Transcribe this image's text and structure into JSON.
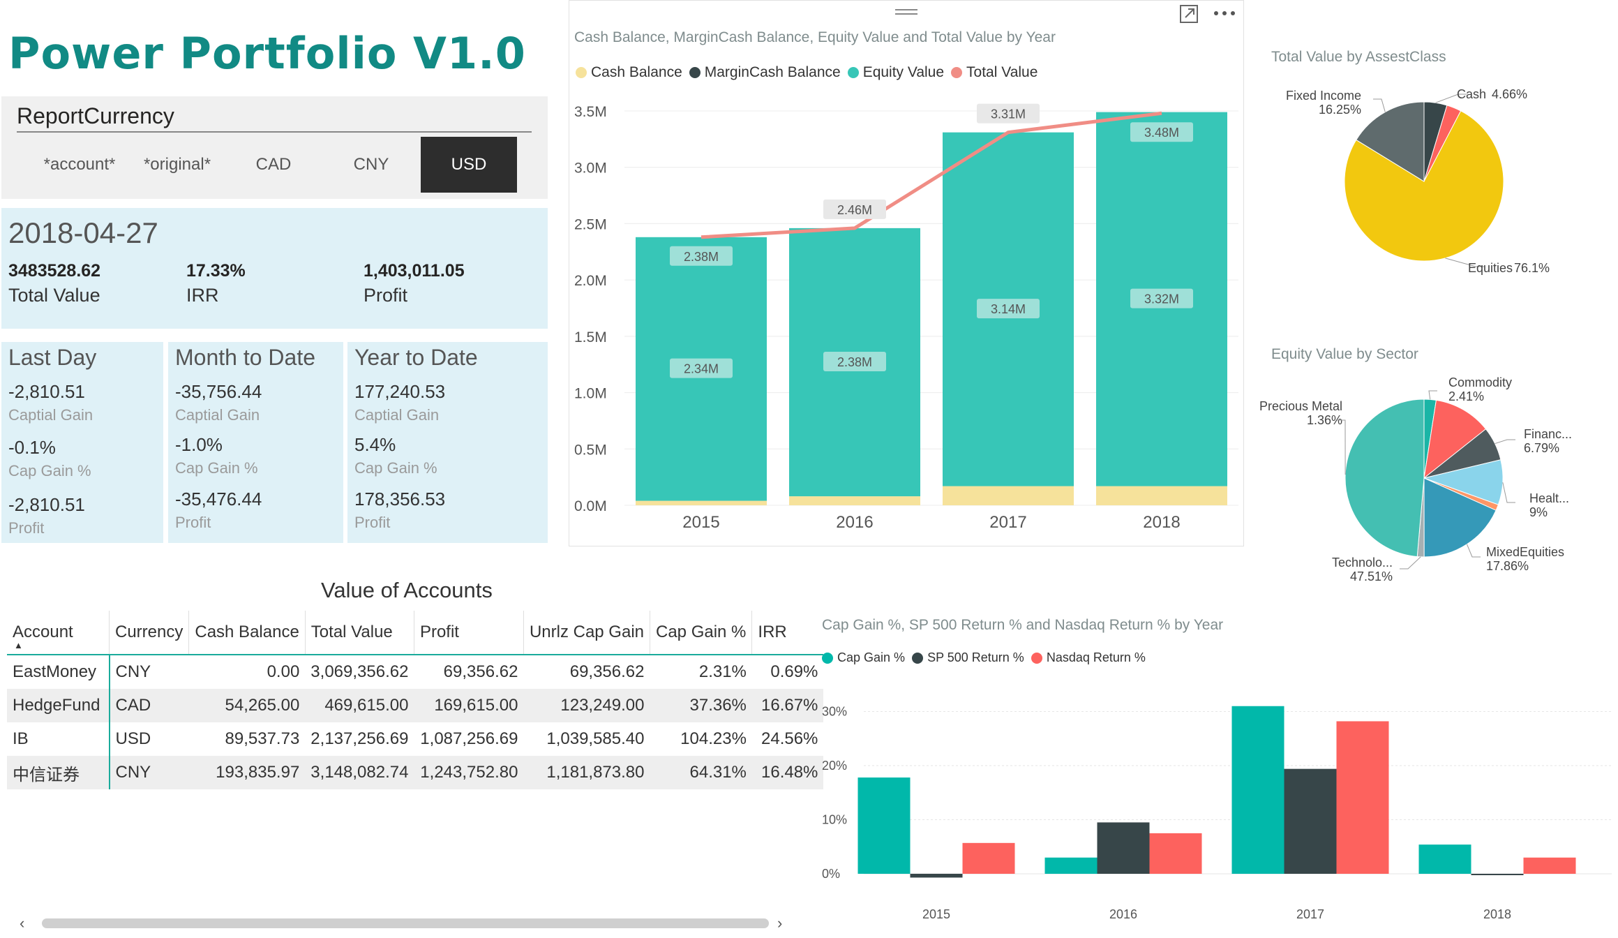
{
  "app_title": "Power Portfolio V1.0",
  "slicer": {
    "title": "ReportCurrency",
    "options": [
      "*account*",
      "*original*",
      "CAD",
      "CNY",
      "USD"
    ],
    "selected": "USD"
  },
  "kpi": {
    "date": "2018-04-27",
    "total_value": "3483528.62",
    "total_value_label": "Total Value",
    "irr": "17.33%",
    "irr_label": "IRR",
    "profit": "1,403,011.05",
    "profit_label": "Profit"
  },
  "periods": [
    {
      "title": "Last Day",
      "cap_gain": "-2,810.51",
      "cap_gain_label": "Captial Gain",
      "cap_gain_pct": "-0.1%",
      "cap_gain_pct_label": "Cap Gain %",
      "profit": "-2,810.51",
      "profit_label": "Profit"
    },
    {
      "title": "Month to Date",
      "cap_gain": "-35,756.44",
      "cap_gain_label": "Captial Gain",
      "cap_gain_pct": "-1.0%",
      "cap_gain_pct_label": "Cap Gain %",
      "profit": "-35,476.44",
      "profit_label": "Profit"
    },
    {
      "title": "Year to Date",
      "cap_gain": "177,240.53",
      "cap_gain_label": "Captial Gain",
      "cap_gain_pct": "5.4%",
      "cap_gain_pct_label": "Cap Gain %",
      "profit": "178,356.53",
      "profit_label": "Profit"
    }
  ],
  "accounts": {
    "title": "Value of Accounts",
    "columns": [
      "Account",
      "Currency",
      "Cash Balance",
      "Total Value",
      "Profit",
      "Unrlz Cap Gain",
      "Cap Gain %",
      "IRR"
    ],
    "rows": [
      [
        "EastMoney",
        "CNY",
        "0.00",
        "3,069,356.62",
        "69,356.62",
        "69,356.62",
        "2.31%",
        "0.69%"
      ],
      [
        "HedgeFund",
        "CAD",
        "54,265.00",
        "469,615.00",
        "169,615.00",
        "123,249.00",
        "37.36%",
        "16.67%"
      ],
      [
        "IB",
        "USD",
        "89,537.73",
        "2,137,256.69",
        "1,087,256.69",
        "1,039,585.40",
        "104.23%",
        "24.56%"
      ],
      [
        "中信证券",
        "CNY",
        "193,835.97",
        "3,148,082.74",
        "1,243,752.80",
        "1,181,873.80",
        "64.31%",
        "16.48%"
      ]
    ]
  },
  "colors": {
    "teal": "#37c6b7",
    "cash": "#f6e29b",
    "line": "#f08d85",
    "dark": "#374649",
    "red": "#fd625e",
    "yellow": "#f2c80f",
    "title": "#118a84"
  },
  "chart_data": [
    {
      "type": "bar",
      "stacked": true,
      "title": "Cash Balance, MarginCash Balance, Equity Value and Total Value by Year",
      "categories": [
        "2015",
        "2016",
        "2017",
        "2018"
      ],
      "series": [
        {
          "name": "Cash Balance",
          "color": "#f6e29b",
          "values": [
            0.04,
            0.08,
            0.17,
            0.17
          ]
        },
        {
          "name": "MarginCash Balance",
          "color": "#374649",
          "values": [
            0,
            0,
            0,
            0
          ]
        },
        {
          "name": "Equity Value",
          "color": "#37c6b7",
          "values": [
            2.34,
            2.38,
            3.14,
            3.32
          ],
          "labels": [
            "2.34M",
            "2.38M",
            "3.14M",
            "3.32M"
          ]
        },
        {
          "name": "Total Value",
          "color": "#f08d85",
          "kind": "line",
          "values": [
            2.38,
            2.46,
            3.31,
            3.48
          ],
          "labels": [
            "2.38M",
            "2.46M",
            "3.31M",
            "3.48M"
          ]
        }
      ],
      "yticks": [
        "0.0M",
        "0.5M",
        "1.0M",
        "1.5M",
        "2.0M",
        "2.5M",
        "3.0M",
        "3.5M"
      ],
      "ylim": [
        0,
        3.5
      ],
      "legend": "top-left"
    },
    {
      "type": "pie",
      "title": "Total Value by AssestClass",
      "slices": [
        {
          "label": "Cash",
          "pct_label": "4.66%",
          "value": 4.66,
          "color": "#374649"
        },
        {
          "label": "",
          "pct_label": "",
          "value": 2.99,
          "color": "#fd625e"
        },
        {
          "label": "Equities",
          "pct_label": "76.1%",
          "value": 76.1,
          "color": "#f2c80f"
        },
        {
          "label": "Fixed Income",
          "pct_label": "16.25%",
          "value": 16.25,
          "color": "#5f6b6d"
        }
      ]
    },
    {
      "type": "pie",
      "title": "Equity Value by Sector",
      "slices": [
        {
          "label": "Commodity",
          "pct_label": "2.41%",
          "value": 2.41,
          "color": "#1ab5a6"
        },
        {
          "label": "",
          "pct_label": "",
          "value": 11.58,
          "color": "#fd625e"
        },
        {
          "label": "Financ...",
          "pct_label": "6.79%",
          "value": 6.79,
          "color": "#4f5b5e"
        },
        {
          "label": "Healt...",
          "pct_label": "9%",
          "value": 9.0,
          "color": "#8ad4eb"
        },
        {
          "label": "",
          "pct_label": "",
          "value": 1.2,
          "color": "#fe9666"
        },
        {
          "label": "MixedEquities",
          "pct_label": "17.86%",
          "value": 17.86,
          "color": "#3599b8"
        },
        {
          "label": "Precious Metal",
          "pct_label": "1.36%",
          "value": 1.36,
          "color": "#a6b0b3"
        },
        {
          "label": "Technolo...",
          "pct_label": "47.51%",
          "value": 47.51,
          "color": "#44bfb2"
        }
      ]
    },
    {
      "type": "bar",
      "title": "Cap Gain %, SP 500 Return % and Nasdaq Return % by Year",
      "categories": [
        "2015",
        "2016",
        "2017",
        "2018"
      ],
      "series": [
        {
          "name": "Cap Gain %",
          "color": "#01b8aa",
          "values": [
            17.8,
            3.0,
            31.0,
            5.4
          ]
        },
        {
          "name": "SP 500 Return %",
          "color": "#374649",
          "values": [
            -0.7,
            9.5,
            19.4,
            -0.2
          ]
        },
        {
          "name": "Nasdaq Return %",
          "color": "#fd625e",
          "values": [
            5.7,
            7.5,
            28.2,
            3.0
          ]
        }
      ],
      "yticks": [
        "0%",
        "10%",
        "20%",
        "30%"
      ],
      "ylim": [
        -2,
        33
      ],
      "legend": "top-left"
    }
  ]
}
